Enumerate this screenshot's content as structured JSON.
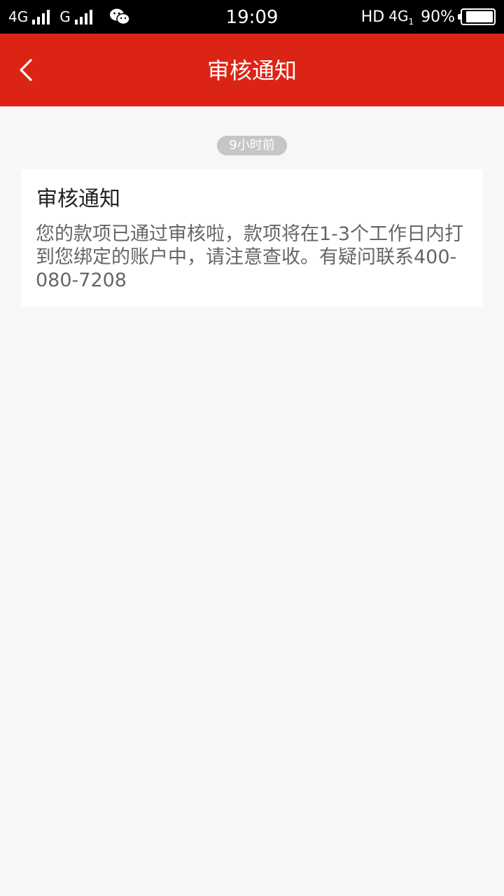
{
  "status_bar": {
    "net1": "4G",
    "net2": "G",
    "time": "19:09",
    "hd": "HD",
    "net_right": "4G",
    "net_right_sub": "1",
    "battery": "90%",
    "battery_level": 0.9
  },
  "nav": {
    "title": "审核通知",
    "back_icon": "chevron-left-icon"
  },
  "message": {
    "time": "9小时前",
    "title": "审核通知",
    "body": "您的款项已通过审核啦，款项将在1-3个工作日内打到您绑定的账户中，请注意查收。有疑问联系400-080-7208"
  },
  "colors": {
    "nav_bg": "#dc2415",
    "page_bg": "#f7f7f7",
    "pill_bg": "#c6c6c6"
  }
}
